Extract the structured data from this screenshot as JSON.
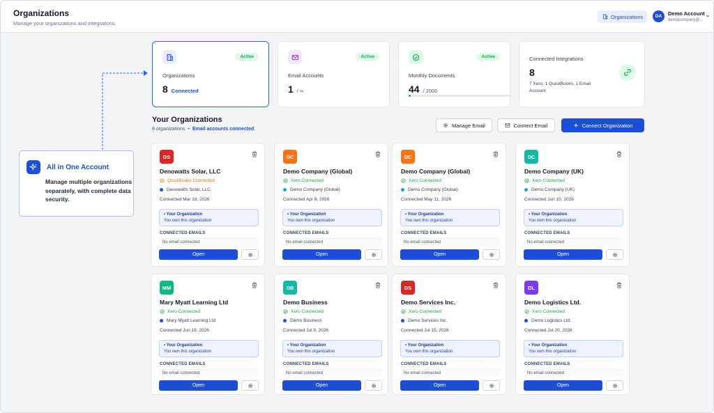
{
  "header": {
    "title": "Organizations",
    "subtitle": "Manage your organizations and integrations",
    "org_chip_label": "Organizations",
    "account": {
      "initials": "DA",
      "name": "Demo Account",
      "email": "democompany@..."
    }
  },
  "stats": [
    {
      "label": "Organizations",
      "value": "8",
      "suffix": "Connected",
      "badge": "Active",
      "icon": "building-icon"
    },
    {
      "label": "Email Accounts",
      "value": "1",
      "suffix": "/ ∞",
      "badge": "Active",
      "icon": "mail-icon"
    },
    {
      "label": "Monthly Documents",
      "value": "44",
      "suffix": "/ 2000",
      "badge": "Active",
      "icon": "check-circle-icon",
      "progress": 0.022
    },
    {
      "label": "Connected Integrations",
      "value": "8",
      "detail": "7 Xero, 1 QuickBooks, 1 Email Account",
      "icon": "link-icon"
    }
  ],
  "section": {
    "title": "Your Organizations",
    "count_text": "8 organizations",
    "separator": "•",
    "emails_link": "Email accounts connected",
    "manage_email": "Manage Email",
    "connect_email": "Connect Email",
    "connect_org": "Connect Organization"
  },
  "callout": {
    "title": "All in One Account",
    "text": "Manage multiple organizations separately, with complete data security."
  },
  "card_labels": {
    "owner_title": "Your Organization",
    "owner_sub": "You own this organization",
    "emails_label": "CONNECTED EMAILS",
    "no_email": "No email connected",
    "open": "Open"
  },
  "organizations": [
    {
      "initials": "DS",
      "color": "#dc2626",
      "name": "Denowatts Solar, LLC",
      "status": "QuickBooks Connected",
      "status_color": "#d97706",
      "entity": "Denowatts Solar, LLC",
      "dot": "#1d4ed8",
      "connected": "Connected Mar 18, 2026"
    },
    {
      "initials": "DC",
      "color": "#f97316",
      "name": "Demo Company (Global)",
      "status": "Xero Connected",
      "status_color": "#16a34a",
      "entity": "Demo Company (Global)",
      "dot": "#0ea5e9",
      "connected": "Connected Apr 8, 2026"
    },
    {
      "initials": "DC",
      "color": "#f97316",
      "name": "Demo Company (Global)",
      "status": "Xero Connected",
      "status_color": "#16a34a",
      "entity": "Demo Company (Global)",
      "dot": "#0ea5e9",
      "connected": "Connected May 11, 2026"
    },
    {
      "initials": "DC",
      "color": "#14b8a6",
      "name": "Demo Company (UK)",
      "status": "Xero Connected",
      "status_color": "#16a34a",
      "entity": "Demo Company (UK)",
      "dot": "#0ea5e9",
      "connected": "Connected Jun 10, 2026"
    },
    {
      "initials": "MM",
      "color": "#10b981",
      "name": "Mary Myatt Learning Ltd",
      "status": "Xero Connected",
      "status_color": "#16a34a",
      "entity": "Mary Myatt Learning Ltd",
      "dot": "#1d4ed8",
      "connected": "Connected Jun 19, 2026"
    },
    {
      "initials": "DB",
      "color": "#14b8a6",
      "name": "Demo Business",
      "status": "Xero Connected",
      "status_color": "#16a34a",
      "entity": "Demo Business",
      "dot": "#1d4ed8",
      "connected": "Connected Jul 9, 2026"
    },
    {
      "initials": "DS",
      "color": "#dc2626",
      "name": "Demo Services Inc.",
      "status": "Xero Connected",
      "status_color": "#16a34a",
      "entity": "Demo Services Inc.",
      "dot": "#1d4ed8",
      "connected": "Connected Jul 15, 2026"
    },
    {
      "initials": "DL",
      "color": "#7c3aed",
      "name": "Demo Logistics Ltd.",
      "status": "Xero Connected",
      "status_color": "#16a34a",
      "entity": "Demo Logistics Ltd.",
      "dot": "#1d4ed8",
      "connected": "Connected Jul 20, 2026"
    }
  ]
}
